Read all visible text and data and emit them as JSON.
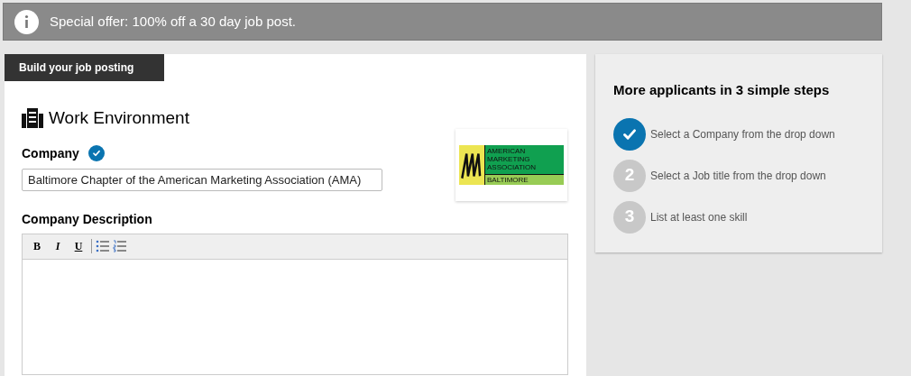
{
  "banner": {
    "text": "Special offer: 100% off a 30 day job post."
  },
  "tab": {
    "label": "Build your job posting"
  },
  "section": {
    "title": "Work Environment"
  },
  "company": {
    "label": "Company",
    "verified": true,
    "value": "Baltimore Chapter of the American Marketing Association (AMA)"
  },
  "logo": {
    "lines": [
      "AMERICAN",
      "MARKETING",
      "ASSOCIATION"
    ],
    "city": "BALTIMORE"
  },
  "description": {
    "label": "Company Description",
    "toolbar": [
      {
        "kind": "text",
        "label": "B"
      },
      {
        "kind": "text",
        "label": "I"
      },
      {
        "kind": "text",
        "label": "U"
      },
      {
        "kind": "bullets"
      },
      {
        "kind": "numbers"
      }
    ]
  },
  "steps_panel": {
    "title": "More applicants in 3 simple steps",
    "steps": [
      {
        "done": true,
        "text": "Select a Company from the drop down"
      },
      {
        "done": false,
        "number": "2",
        "text": "Select a Job title from the drop down"
      },
      {
        "done": false,
        "number": "3",
        "text": "List at least one skill"
      }
    ]
  }
}
